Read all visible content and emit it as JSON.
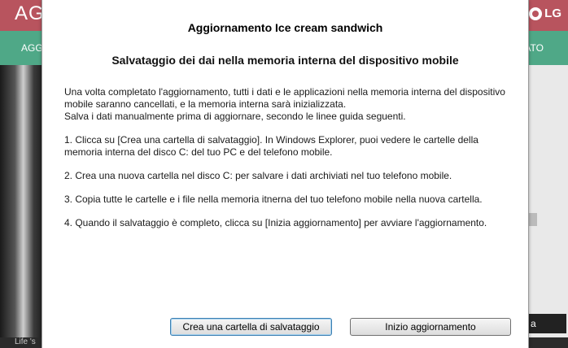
{
  "background": {
    "app_title": "AGG",
    "logo_text": "LG",
    "nav_left": "AGGI",
    "nav_right": "ATO",
    "side_button": "a",
    "footer_text": "Life 's"
  },
  "dialog": {
    "title": "Aggiornamento Ice cream sandwich",
    "heading": "Salvataggio dei dai nella memoria interna del dispositivo mobile",
    "intro_line1": "Una volta completato l'aggiornamento, tutti i dati e le applicazioni nella memoria interna del dispositivo mobile saranno cancellati, e la memoria interna sarà inizializzata.",
    "intro_line2": "Salva i dati manualmente prima di aggiornare, secondo le linee guida seguenti.",
    "step1": "1. Clicca su [Crea una cartella di salvataggio]. In Windows Explorer, puoi vedere le cartelle della memoria interna del disco C: del tuo PC e del telefono mobile.",
    "step2": "2. Crea una nuova cartella nel disco C: per salvare i dati archiviati nel tuo telefono mobile.",
    "step3": "3. Copia tutte le cartelle e i file nella memoria itnerna del tuo telefono mobile nella nuova cartella.",
    "step4": "4. Quando il salvataggio è completo, clicca su [Inizia aggiornamento] per avviare l'aggiornamento.",
    "backup_button": "Crea una cartella di salvataggio",
    "update_button": "Inizio aggiornamento"
  }
}
